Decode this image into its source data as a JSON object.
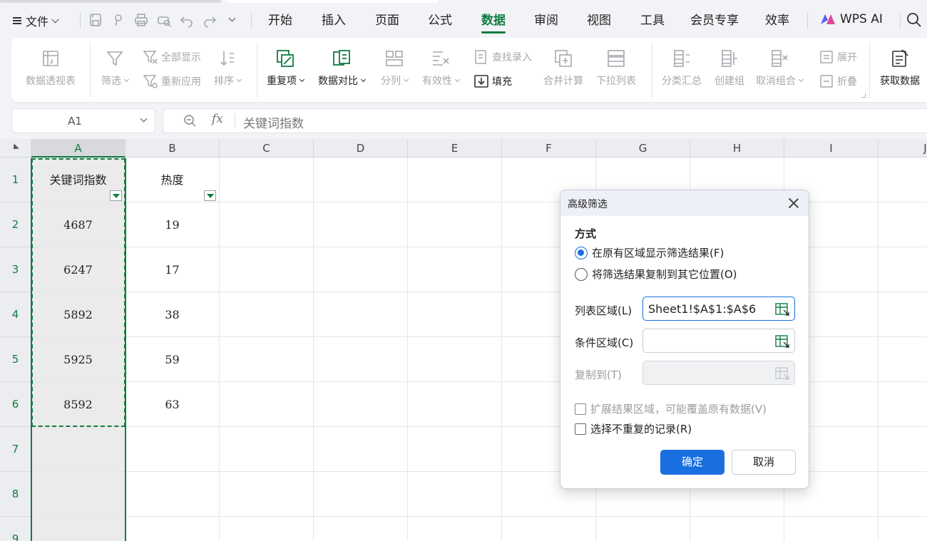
{
  "menubar": {
    "file_label": "文件",
    "items": [
      "开始",
      "插入",
      "页面",
      "公式",
      "数据",
      "审阅",
      "视图",
      "工具",
      "会员专享",
      "效率"
    ],
    "active": "数据",
    "ai_label": "WPS AI"
  },
  "ribbon": {
    "pivot": "数据透视表",
    "filter": "筛选",
    "show_all": "全部显示",
    "reapply": "重新应用",
    "sort": "排序",
    "duplicates": "重复项",
    "compare": "数据对比",
    "split": "分列",
    "validity": "有效性",
    "lookup_entry": "查找录入",
    "fill": "填充",
    "consolidate": "合并计算",
    "dropdown_list": "下拉列表",
    "subtotal": "分类汇总",
    "create_group": "创建组",
    "ungroup": "取消组合",
    "expand": "展开",
    "collapse": "折叠",
    "get_data": "获取数据"
  },
  "formula_bar": {
    "cell_ref": "A1",
    "fx_label": "fx",
    "content": "关键词指数"
  },
  "sheet": {
    "columns": [
      "A",
      "B",
      "C",
      "D",
      "E",
      "F",
      "G",
      "H",
      "I",
      "J"
    ],
    "rows": [
      "1",
      "2",
      "3",
      "4",
      "5",
      "6",
      "7",
      "8",
      "9"
    ],
    "data": [
      [
        "关键词指数",
        "热度"
      ],
      [
        "4687",
        "19"
      ],
      [
        "6247",
        "17"
      ],
      [
        "5892",
        "38"
      ],
      [
        "5925",
        "59"
      ],
      [
        "8592",
        "63"
      ]
    ]
  },
  "dialog": {
    "title": "高级筛选",
    "section_title": "方式",
    "option_in_place": "在原有区域显示筛选结果(F)",
    "option_copy": "将筛选结果复制到其它位置(O)",
    "list_range_label": "列表区域(L)",
    "list_range_value": "Sheet1!$A$1:$A$6",
    "criteria_range_label": "条件区域(C)",
    "criteria_range_value": "",
    "copy_to_label": "复制到(T)",
    "copy_to_value": "",
    "extend_label": "扩展结果区域，可能覆盖原有数据(V)",
    "unique_label": "选择不重复的记录(R)",
    "ok_label": "确定",
    "cancel_label": "取消"
  },
  "colors": {
    "accent_green": "#107c41",
    "primary_blue": "#1a6fe0"
  }
}
